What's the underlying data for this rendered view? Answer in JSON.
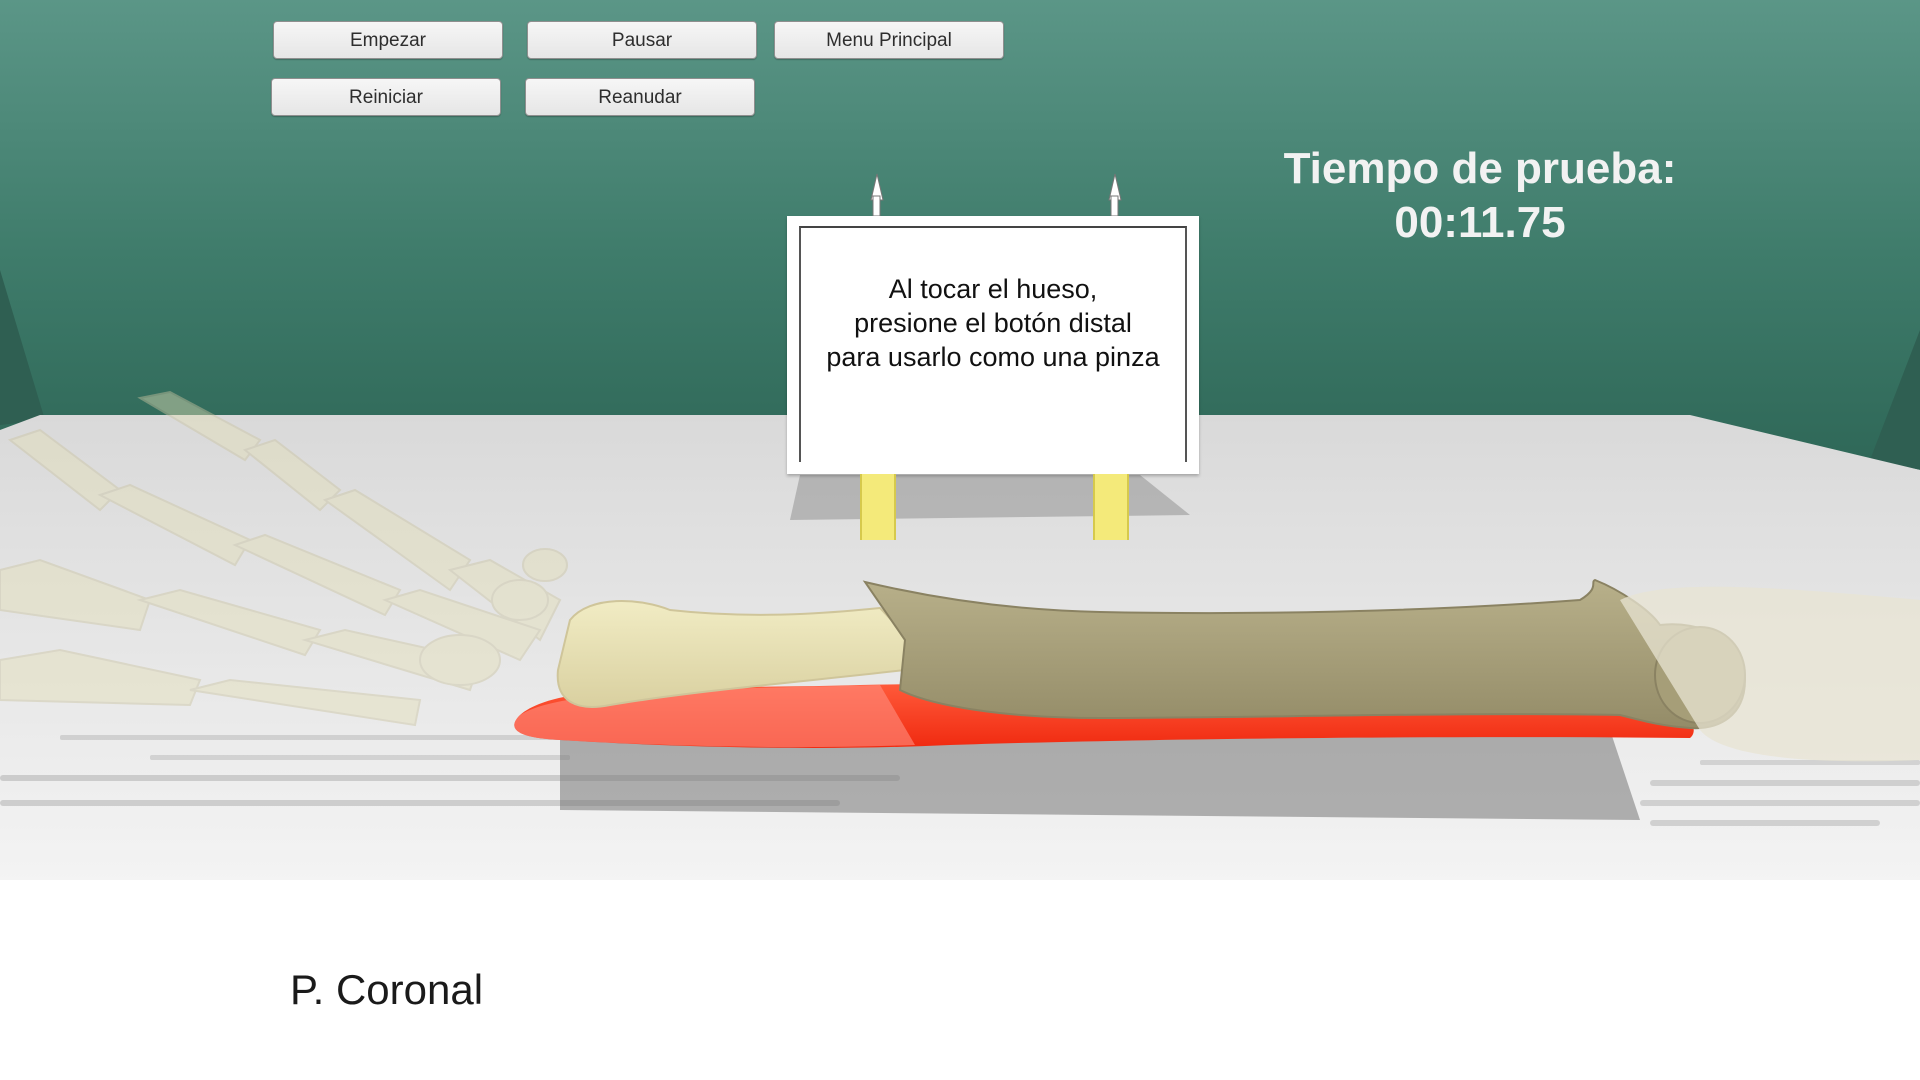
{
  "toolbar": {
    "start_label": "Empezar",
    "pause_label": "Pausar",
    "main_menu_label": "Menu Principal",
    "restart_label": "Reiniciar",
    "resume_label": "Reanudar"
  },
  "timer": {
    "label": "Tiempo de prueba:",
    "value": "00:11.75"
  },
  "sign": {
    "lines": [
      "Al tocar el hueso,",
      "presione el botón distal",
      "para usarlo como una pinza"
    ]
  },
  "view": {
    "plane_label": "P. Coronal"
  },
  "colors": {
    "wall": "#4a8a7a",
    "table": "#eeeeee",
    "bone": "#e6dfae",
    "bone_dark": "#a59d77",
    "muscle": "#ff3b1f",
    "sign_leg": "#f4ea7a"
  },
  "icons": [
    "bone-model-icon",
    "skeleton-hand-icon",
    "pin-icon"
  ]
}
